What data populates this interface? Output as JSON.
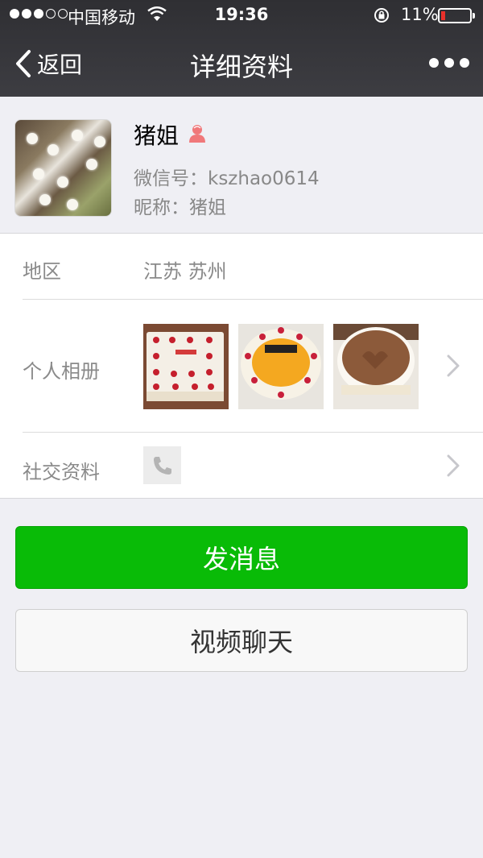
{
  "status_bar": {
    "carrier": "中国移动",
    "time": "19:36",
    "battery_percent": "11%",
    "signal_bars_full": 3,
    "signal_bars_total": 5
  },
  "nav": {
    "back_label": "返回",
    "title": "详细资料",
    "more_icon": "ellipsis-icon"
  },
  "profile": {
    "name": "猪姐",
    "gender_icon": "female-icon",
    "wechat_id": "微信号：kszhao0614",
    "nickname": "昵称：猪姐"
  },
  "rows": {
    "region_label": "地区",
    "region_value": "江苏 苏州",
    "album_label": "个人相册",
    "social_label": "社交资料",
    "social_icon": "phone-icon"
  },
  "buttons": {
    "send_message": "发消息",
    "video_chat": "视频聊天"
  },
  "colors": {
    "primary_green": "#09bb07",
    "header_dark": "#363639",
    "background": "#efeff4"
  }
}
